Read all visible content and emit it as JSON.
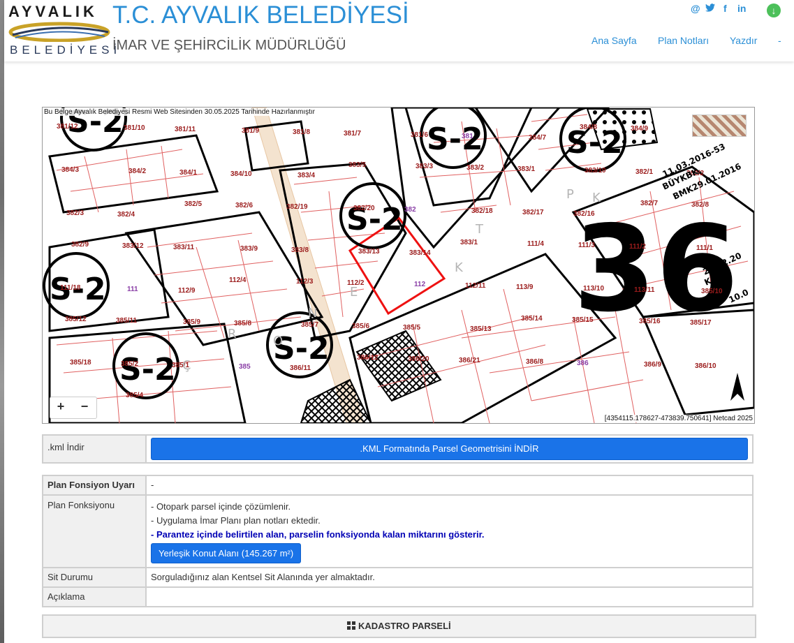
{
  "header": {
    "logo_top": "AYVALIK",
    "logo_bottom": "BELEDİYESİ",
    "title": "T.C. AYVALIK BELEDİYESİ",
    "subtitle": "İMAR VE ŞEHİRCİLİK MÜDÜRLÜĞÜ",
    "social": {
      "email": "@",
      "twitter": "🐦",
      "facebook": "f",
      "linkedin": "in"
    },
    "download_icon": "↓",
    "nav": [
      "Ana Sayfa",
      "Plan Notları",
      "Yazdır",
      "-"
    ]
  },
  "map": {
    "note": "Bu Belge Ayvalık Belediyesi Resmi Web Sitesinden 30.05.2025 Tarihinde Hazırlanmıştır",
    "coords": "[4354115.178627-473839.750641] Netcad 2025",
    "zoom_in": "+",
    "zoom_out": "−",
    "zone_labels": [
      "S-2",
      "S-2",
      "S-2",
      "S-2",
      "S-2",
      "S-2",
      "S-2"
    ],
    "big_number": "36",
    "parcel_labels": [
      "381/12",
      "381/10",
      "381/11",
      "381/9",
      "381/8",
      "381/7",
      "381/6",
      "381",
      "384/7",
      "384/8",
      "384/9",
      "384/5",
      "384/3",
      "384/2",
      "384/1",
      "384/10",
      "383/4",
      "383/5",
      "383/3",
      "383/2",
      "383/1",
      "383/10",
      "382/1",
      "382/2",
      "382/3",
      "382/4",
      "382/5",
      "382/6",
      "382/19",
      "382/20",
      "382",
      "382/18",
      "382/17",
      "382/16",
      "382/7",
      "382/8",
      "382/9",
      "383/12",
      "383/11",
      "383/9",
      "383/8",
      "383/13",
      "383/14",
      "383/1",
      "111/4",
      "111/3",
      "111/2",
      "111/1",
      "111/18",
      "111",
      "112/9",
      "112/4",
      "112/3",
      "112/2",
      "112",
      "112/11",
      "113/9",
      "113/10",
      "113/11",
      "385/10",
      "385/12",
      "385/11",
      "385/9",
      "385/8",
      "385/7",
      "385/6",
      "385/5",
      "385/13",
      "385/14",
      "385/15",
      "385/16",
      "385/17",
      "385/18",
      "385/2",
      "385/1",
      "385",
      "386/11",
      "386/12",
      "386/20",
      "386/21",
      "386/8",
      "386",
      "386/9",
      "386/10",
      "385/3",
      "385/4"
    ],
    "street_letters": [
      "E",
      "N",
      "O",
      "K",
      "R",
      "T",
      "P",
      "K",
      "Ç"
    ],
    "annotations": [
      "11.03.2016-53",
      "BÜYKBK",
      "BMK29.01.2016",
      "29.12.20",
      "KBK",
      "10.0"
    ]
  },
  "kml": {
    "label": ".kml İndir",
    "button": ".KML Formatında Parsel Geometrisini İNDİR"
  },
  "plan": {
    "warning_label": "Plan Fonsiyon Uyarı",
    "warning_value": "-",
    "function_label": "Plan Fonksiyonu",
    "function_lines": [
      "- Otopark parsel içinde çözümlenir.",
      "- Uygulama İmar Planı plan notları ektedir."
    ],
    "function_bold": "- Parantez içinde belirtilen alan, parselin fonksiyonda kalan miktarını gösterir.",
    "function_button": "Yerleşik Konut Alanı (145.267 m²)",
    "sit_label": "Sit Durumu",
    "sit_value": "Sorguladığınız alan Kentsel Sit Alanında yer almaktadır.",
    "desc_label": "Açıklama",
    "desc_value": ""
  },
  "kadastro": {
    "icon": "grid-icon",
    "title": "KADASTRO PARSELİ"
  }
}
